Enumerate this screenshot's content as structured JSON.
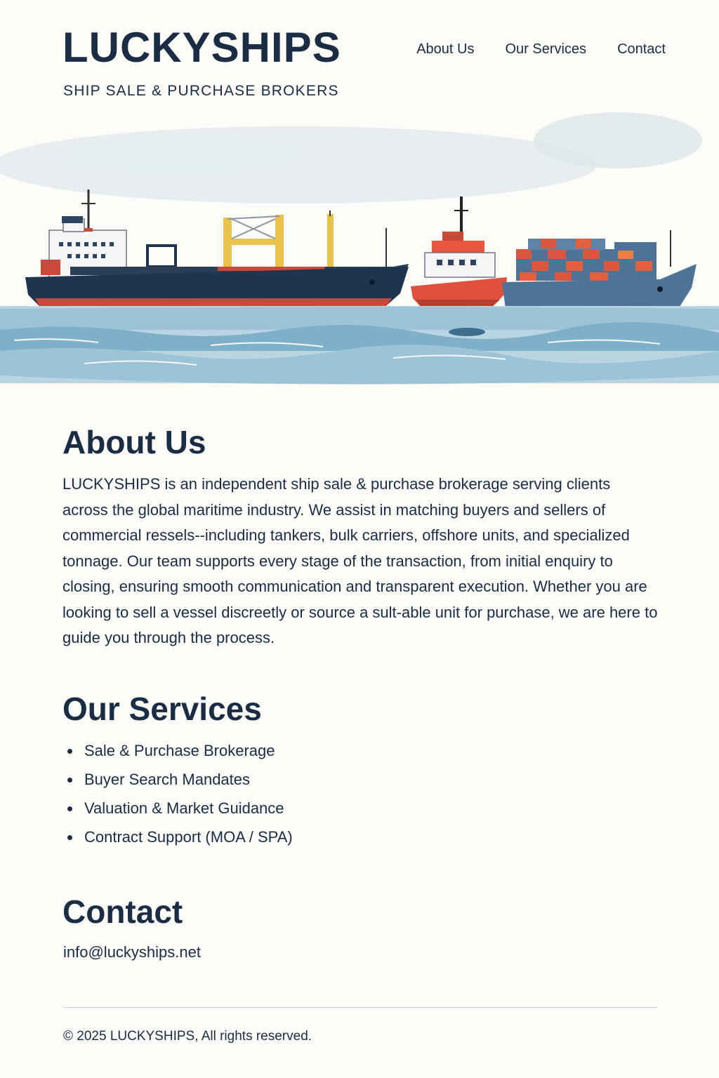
{
  "header": {
    "brand": "LUCKYSHIPS",
    "tagline": "SHIP SALE & PURCHASE BROKERS",
    "nav": [
      "About Us",
      "Our Services",
      "Contact"
    ]
  },
  "about": {
    "title": "About Us",
    "body": "LUCKYSHIPS is an independent ship sale & purchase brokerage serving clients across the global maritime industry. We assist in matching buyers and sellers of commercial ressels--including tankers, bulk carriers, offshore units, and specialized tonnage. Our team supports every stage of the transaction, from initial enquiry to closing, ensuring smooth communication and transparent execution. Whether you are looking to sell a vessel discreetly or source a sult-able unit for purchase, we are here to guide you through the process."
  },
  "services": {
    "title": "Our Services",
    "items": [
      "Sale & Purchase Brokerage",
      "Buyer Search Mandates",
      "Valuation & Market Guidance",
      "Contract Support (MOA / SPA)"
    ]
  },
  "contact": {
    "title": "Contact",
    "email": "info@luckyships.net"
  },
  "footer": {
    "copyright": "© 2025 LUCKYSHIPS, All rights reserved."
  },
  "colors": {
    "text": "#1b2c45",
    "background": "#fcfcf9",
    "water": "#6ea3c0",
    "hull_dark": "#1f344f",
    "hull_red": "#c9493a",
    "container_blue": "#4d7397",
    "mast_yellow": "#e8c24a"
  },
  "icons": [
    "bulk-carrier-illustration",
    "tug-boat-illustration",
    "container-ship-illustration"
  ]
}
